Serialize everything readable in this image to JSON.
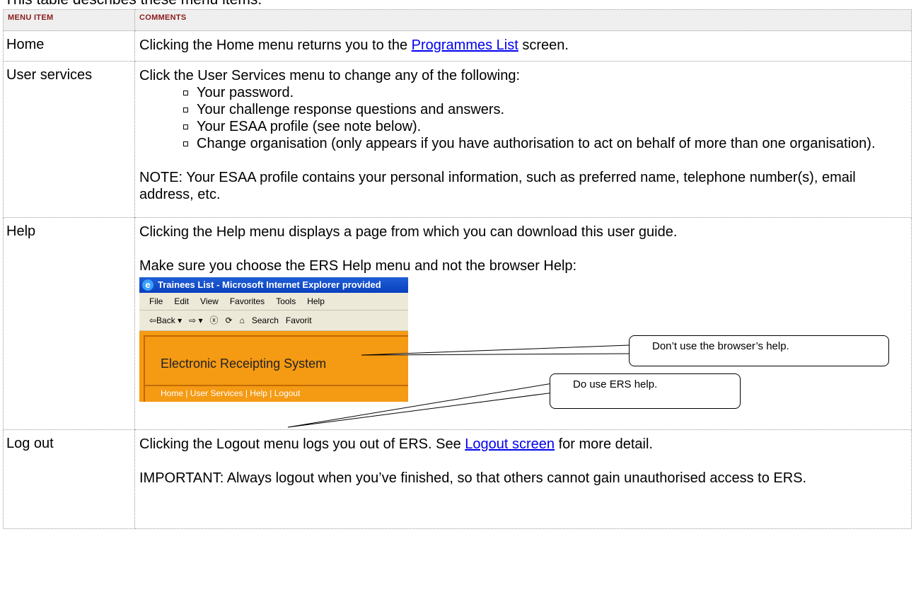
{
  "intro": "This table describes these menu items.",
  "table": {
    "headers": [
      "Menu item",
      "Comments"
    ],
    "rows": {
      "home": {
        "item": "Home",
        "text_before": "Clicking the Home menu returns you to the ",
        "link": "Programmes List",
        "text_after": " screen."
      },
      "user_services": {
        "item": "User services",
        "lead": "Click the User Services menu to change any of the following:",
        "bullets": [
          "Your password.",
          "Your challenge response questions and answers.",
          "Your ESAA profile (see note below).",
          "Change organisation (only appears if you have authorisation to act on behalf of more than one organisation)."
        ],
        "note": "NOTE:  Your ESAA profile contains your personal information, such as preferred name, telephone number(s), email address, etc."
      },
      "help": {
        "item": "Help",
        "text1": "Clicking the Help menu displays a page from which you can download this user guide.",
        "text2": "Make sure you choose the ERS Help menu and not the browser Help:",
        "screenshot": {
          "window_title": "Trainees List - Microsoft Internet Explorer provided",
          "menus": [
            "File",
            "Edit",
            "View",
            "Favorites",
            "Tools",
            "Help"
          ],
          "toolbar": [
            "⇦Back ▾",
            "⇨ ▾",
            "ⓧ",
            "⟳",
            "⌂",
            "Search",
            "Favorit"
          ],
          "banner_title": "Electronic Receipting System",
          "nav": "Home | User Services | Help | Logout",
          "callout_browser": "Don’t use the browser’s help.",
          "callout_ers": "Do use ERS help."
        }
      },
      "logout": {
        "item": "Log out",
        "text_before": "Clicking the Logout menu logs you out of ERS.  See ",
        "link": "Logout screen",
        "text_after": " for more detail.",
        "important": "IMPORTANT:  Always logout when you’ve finished, so that others cannot gain unauthorised access to ERS."
      }
    }
  }
}
